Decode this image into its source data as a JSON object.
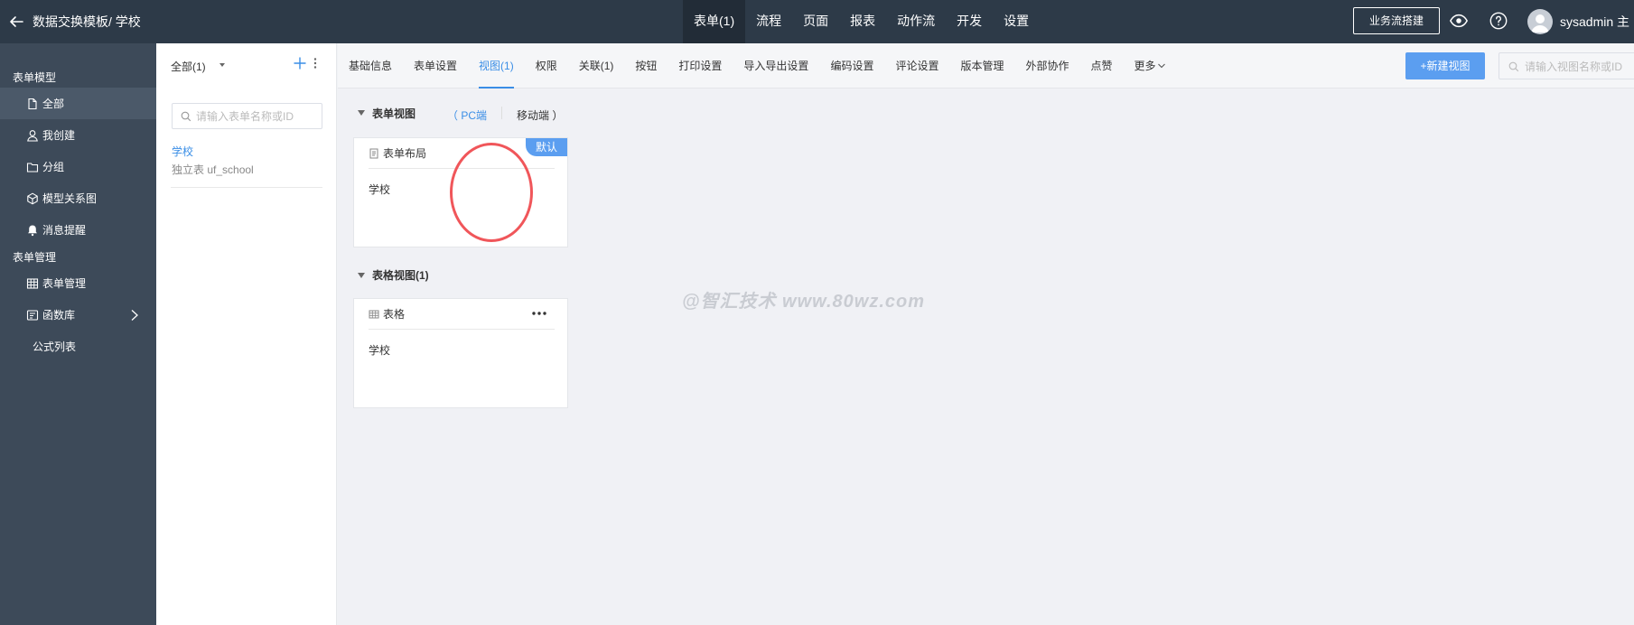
{
  "header": {
    "title": "数据交换模板/ 学校",
    "nav": [
      "表单(1)",
      "流程",
      "页面",
      "报表",
      "动作流",
      "开发",
      "设置"
    ],
    "active_nav": "表单(1)",
    "biz_button": "业务流搭建",
    "username": "sysadmin 主"
  },
  "sidebar": {
    "section_models": "表单模型",
    "items_models": [
      {
        "label": "全部",
        "icon": "file-icon"
      },
      {
        "label": "我创建",
        "icon": "user-icon"
      },
      {
        "label": "分组",
        "icon": "folder-icon"
      },
      {
        "label": "模型关系图",
        "icon": "cube-icon"
      },
      {
        "label": "消息提醒",
        "icon": "bell-icon"
      }
    ],
    "section_manage": "表单管理",
    "items_manage": [
      {
        "label": "表单管理",
        "icon": "table-icon"
      },
      {
        "label": "函数库",
        "icon": "function-icon"
      },
      {
        "label": "公式列表",
        "icon": ""
      }
    ]
  },
  "formlist": {
    "dropdown": "全部(1)",
    "search_placeholder": "请输入表单名称或ID",
    "entries": [
      {
        "name": "学校",
        "sub": "独立表 uf_school"
      }
    ]
  },
  "tabs": [
    "基础信息",
    "表单设置",
    "视图(1)",
    "权限",
    "关联(1)",
    "按钮",
    "打印设置",
    "导入导出设置",
    "编码设置",
    "评论设置",
    "版本管理",
    "外部协作",
    "点赞",
    "更多"
  ],
  "active_tab": "视图(1)",
  "toolbar": {
    "new_view": "+新建视图",
    "search_placeholder": "请输入视图名称或ID"
  },
  "form_views": {
    "title": "表单视图",
    "pc_label": "（ PC端",
    "mobile_label": "移动端 ）",
    "card": {
      "title": "表单布局",
      "body": "学校",
      "badge": "默认"
    }
  },
  "table_views": {
    "title": "表格视图(1)",
    "card": {
      "title": "表格",
      "body": "学校"
    }
  },
  "watermark": "@智汇技术 www.80wz.com",
  "colors": {
    "topbar": "#2d3a48",
    "sidebar": "#3d4a59",
    "accent": "#3a8ee6",
    "button": "#5b9ef0",
    "annotation": "#f0565a"
  }
}
